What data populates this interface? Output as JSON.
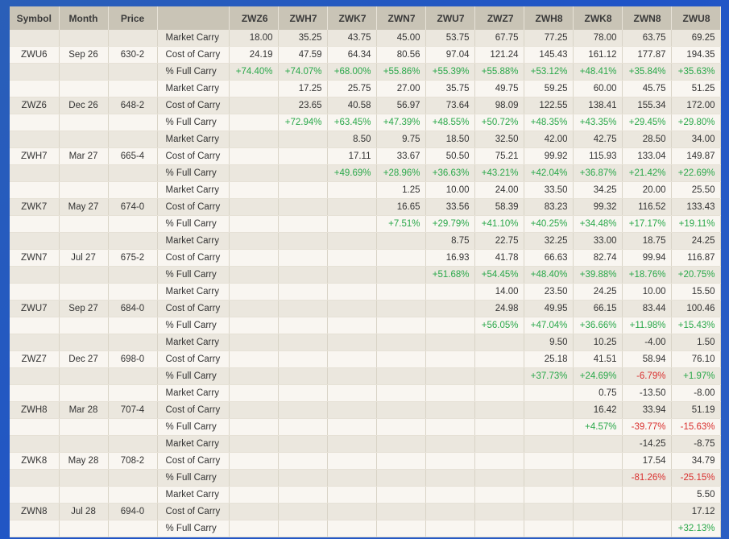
{
  "header": [
    "Symbol",
    "Month",
    "Price",
    "",
    "ZWZ6",
    "ZWH7",
    "ZWK7",
    "ZWN7",
    "ZWU7",
    "ZWZ7",
    "ZWH8",
    "ZWK8",
    "ZWN8",
    "ZWU8"
  ],
  "groups": [
    {
      "symbol": "ZWU6",
      "month": "Sep 26",
      "price": "630-2",
      "market": [
        "18.00",
        "35.25",
        "43.75",
        "45.00",
        "53.75",
        "67.75",
        "77.25",
        "78.00",
        "63.75",
        "69.25"
      ],
      "cost": [
        "24.19",
        "47.59",
        "64.34",
        "80.56",
        "97.04",
        "121.24",
        "145.43",
        "161.12",
        "177.87",
        "194.35"
      ],
      "pct": [
        "+74.40%",
        "+74.07%",
        "+68.00%",
        "+55.86%",
        "+55.39%",
        "+55.88%",
        "+53.12%",
        "+48.41%",
        "+35.84%",
        "+35.63%"
      ]
    },
    {
      "symbol": "ZWZ6",
      "month": "Dec 26",
      "price": "648-2",
      "market": [
        "",
        "17.25",
        "25.75",
        "27.00",
        "35.75",
        "49.75",
        "59.25",
        "60.00",
        "45.75",
        "51.25"
      ],
      "cost": [
        "",
        "23.65",
        "40.58",
        "56.97",
        "73.64",
        "98.09",
        "122.55",
        "138.41",
        "155.34",
        "172.00"
      ],
      "pct": [
        "",
        "+72.94%",
        "+63.45%",
        "+47.39%",
        "+48.55%",
        "+50.72%",
        "+48.35%",
        "+43.35%",
        "+29.45%",
        "+29.80%"
      ]
    },
    {
      "symbol": "ZWH7",
      "month": "Mar 27",
      "price": "665-4",
      "market": [
        "",
        "",
        "8.50",
        "9.75",
        "18.50",
        "32.50",
        "42.00",
        "42.75",
        "28.50",
        "34.00"
      ],
      "cost": [
        "",
        "",
        "17.11",
        "33.67",
        "50.50",
        "75.21",
        "99.92",
        "115.93",
        "133.04",
        "149.87"
      ],
      "pct": [
        "",
        "",
        "+49.69%",
        "+28.96%",
        "+36.63%",
        "+43.21%",
        "+42.04%",
        "+36.87%",
        "+21.42%",
        "+22.69%"
      ]
    },
    {
      "symbol": "ZWK7",
      "month": "May 27",
      "price": "674-0",
      "market": [
        "",
        "",
        "",
        "1.25",
        "10.00",
        "24.00",
        "33.50",
        "34.25",
        "20.00",
        "25.50"
      ],
      "cost": [
        "",
        "",
        "",
        "16.65",
        "33.56",
        "58.39",
        "83.23",
        "99.32",
        "116.52",
        "133.43"
      ],
      "pct": [
        "",
        "",
        "",
        "+7.51%",
        "+29.79%",
        "+41.10%",
        "+40.25%",
        "+34.48%",
        "+17.17%",
        "+19.11%"
      ]
    },
    {
      "symbol": "ZWN7",
      "month": "Jul 27",
      "price": "675-2",
      "market": [
        "",
        "",
        "",
        "",
        "8.75",
        "22.75",
        "32.25",
        "33.00",
        "18.75",
        "24.25"
      ],
      "cost": [
        "",
        "",
        "",
        "",
        "16.93",
        "41.78",
        "66.63",
        "82.74",
        "99.94",
        "116.87"
      ],
      "pct": [
        "",
        "",
        "",
        "",
        "+51.68%",
        "+54.45%",
        "+48.40%",
        "+39.88%",
        "+18.76%",
        "+20.75%"
      ]
    },
    {
      "symbol": "ZWU7",
      "month": "Sep 27",
      "price": "684-0",
      "market": [
        "",
        "",
        "",
        "",
        "",
        "14.00",
        "23.50",
        "24.25",
        "10.00",
        "15.50"
      ],
      "cost": [
        "",
        "",
        "",
        "",
        "",
        "24.98",
        "49.95",
        "66.15",
        "83.44",
        "100.46"
      ],
      "pct": [
        "",
        "",
        "",
        "",
        "",
        "+56.05%",
        "+47.04%",
        "+36.66%",
        "+11.98%",
        "+15.43%"
      ]
    },
    {
      "symbol": "ZWZ7",
      "month": "Dec 27",
      "price": "698-0",
      "market": [
        "",
        "",
        "",
        "",
        "",
        "",
        "9.50",
        "10.25",
        "-4.00",
        "1.50"
      ],
      "cost": [
        "",
        "",
        "",
        "",
        "",
        "",
        "25.18",
        "41.51",
        "58.94",
        "76.10"
      ],
      "pct": [
        "",
        "",
        "",
        "",
        "",
        "",
        "+37.73%",
        "+24.69%",
        "-6.79%",
        "+1.97%"
      ]
    },
    {
      "symbol": "ZWH8",
      "month": "Mar 28",
      "price": "707-4",
      "market": [
        "",
        "",
        "",
        "",
        "",
        "",
        "",
        "0.75",
        "-13.50",
        "-8.00"
      ],
      "cost": [
        "",
        "",
        "",
        "",
        "",
        "",
        "",
        "16.42",
        "33.94",
        "51.19"
      ],
      "pct": [
        "",
        "",
        "",
        "",
        "",
        "",
        "",
        "+4.57%",
        "-39.77%",
        "-15.63%"
      ]
    },
    {
      "symbol": "ZWK8",
      "month": "May 28",
      "price": "708-2",
      "market": [
        "",
        "",
        "",
        "",
        "",
        "",
        "",
        "",
        "-14.25",
        "-8.75"
      ],
      "cost": [
        "",
        "",
        "",
        "",
        "",
        "",
        "",
        "",
        "17.54",
        "34.79"
      ],
      "pct": [
        "",
        "",
        "",
        "",
        "",
        "",
        "",
        "",
        "-81.26%",
        "-25.15%"
      ]
    },
    {
      "symbol": "ZWN8",
      "month": "Jul 28",
      "price": "694-0",
      "market": [
        "",
        "",
        "",
        "",
        "",
        "",
        "",
        "",
        "",
        "5.50"
      ],
      "cost": [
        "",
        "",
        "",
        "",
        "",
        "",
        "",
        "",
        "",
        "17.12"
      ],
      "pct": [
        "",
        "",
        "",
        "",
        "",
        "",
        "",
        "",
        "",
        "+32.13%"
      ]
    }
  ],
  "row_labels": {
    "market": "Market Carry",
    "cost": "Cost of Carry",
    "pct": "% Full Carry"
  },
  "colors": {
    "positive": "#2aa84a",
    "negative": "#d9302f",
    "header_bg": "#c9c4b6"
  }
}
